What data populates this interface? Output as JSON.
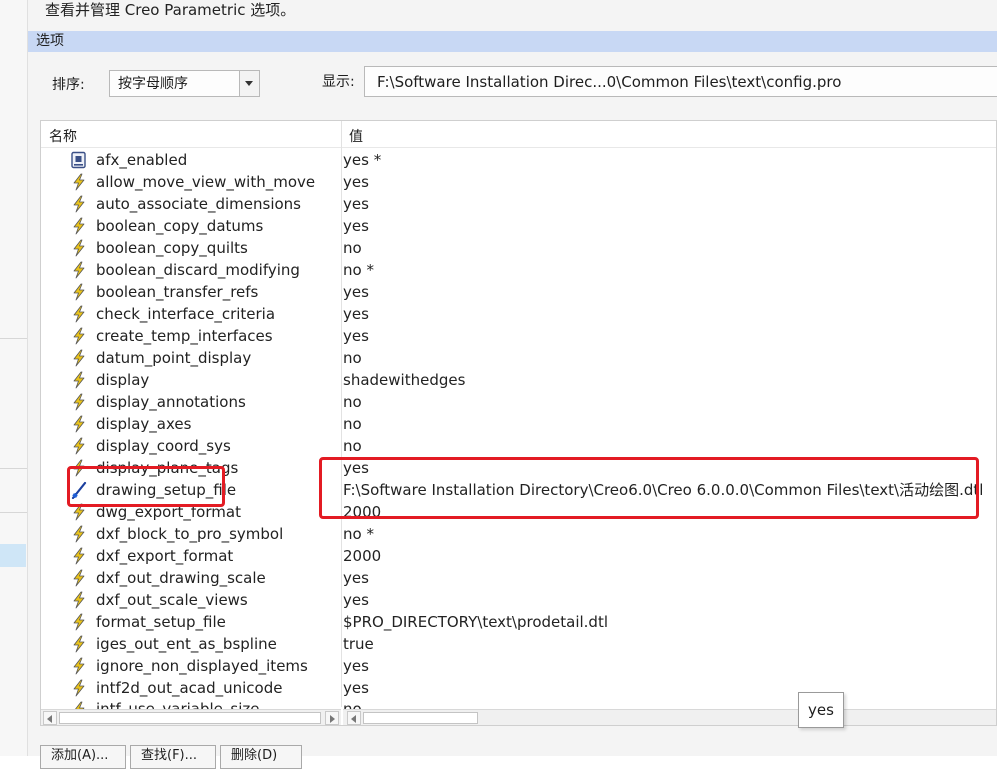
{
  "header": {
    "description": "查看并管理 Creo Parametric 选项。",
    "section_title": "选项"
  },
  "toolbar": {
    "sort_label": "排序:",
    "sort_value": "按字母顺序",
    "show_label": "显示:",
    "show_value": "F:\\Software Installation Direc...0\\Common Files\\text\\config.pro"
  },
  "table": {
    "columns": {
      "name": "名称",
      "value": "值"
    },
    "rows": [
      {
        "name": "afx_enabled",
        "value": "yes *",
        "icon": "gray-config-icon"
      },
      {
        "name": "allow_move_view_with_move",
        "value": "yes",
        "icon": "lightning-icon"
      },
      {
        "name": "auto_associate_dimensions",
        "value": "yes",
        "icon": "lightning-icon"
      },
      {
        "name": "boolean_copy_datums",
        "value": "yes",
        "icon": "lightning-icon"
      },
      {
        "name": "boolean_copy_quilts",
        "value": "no",
        "icon": "lightning-icon"
      },
      {
        "name": "boolean_discard_modifying",
        "value": "no *",
        "icon": "lightning-icon"
      },
      {
        "name": "boolean_transfer_refs",
        "value": "yes",
        "icon": "lightning-icon"
      },
      {
        "name": "check_interface_criteria",
        "value": "yes",
        "icon": "lightning-icon"
      },
      {
        "name": "create_temp_interfaces",
        "value": "yes",
        "icon": "lightning-icon"
      },
      {
        "name": "datum_point_display",
        "value": "no",
        "icon": "lightning-icon"
      },
      {
        "name": "display",
        "value": "shadewithedges",
        "icon": "lightning-icon"
      },
      {
        "name": "display_annotations",
        "value": "no",
        "icon": "lightning-icon"
      },
      {
        "name": "display_axes",
        "value": "no",
        "icon": "lightning-icon"
      },
      {
        "name": "display_coord_sys",
        "value": "no",
        "icon": "lightning-icon"
      },
      {
        "name": "display_plane_tags",
        "value": "yes",
        "icon": "lightning-icon"
      },
      {
        "name": "drawing_setup_file",
        "value": "F:\\Software Installation Directory\\Creo6.0\\Creo 6.0.0.0\\Common Files\\text\\活动绘图.dtl",
        "icon": "modified-star-icon"
      },
      {
        "name": "dwg_export_format",
        "value": "2000",
        "icon": "lightning-icon"
      },
      {
        "name": "dxf_block_to_pro_symbol",
        "value": "no *",
        "icon": "lightning-icon"
      },
      {
        "name": "dxf_export_format",
        "value": "2000",
        "icon": "lightning-icon"
      },
      {
        "name": "dxf_out_drawing_scale",
        "value": "yes",
        "icon": "lightning-icon"
      },
      {
        "name": "dxf_out_scale_views",
        "value": "yes",
        "icon": "lightning-icon"
      },
      {
        "name": "format_setup_file",
        "value": "$PRO_DIRECTORY\\text\\prodetail.dtl",
        "icon": "lightning-icon"
      },
      {
        "name": "iges_out_ent_as_bspline",
        "value": "true",
        "icon": "lightning-icon"
      },
      {
        "name": "ignore_non_displayed_items",
        "value": "yes",
        "icon": "lightning-icon"
      },
      {
        "name": "intf2d_out_acad_unicode",
        "value": "yes",
        "icon": "lightning-icon"
      },
      {
        "name": "intf_use_variable_size",
        "value": "no",
        "icon": "lightning-icon"
      }
    ]
  },
  "tooltip": {
    "text": "yes"
  },
  "bottom_buttons": [
    {
      "label": "添加(A)..."
    },
    {
      "label": "查找(F)..."
    },
    {
      "label": "删除(D)"
    }
  ],
  "colors": {
    "accent_header": "#c8d8f4",
    "highlight": "#e31b23",
    "lightning": "#e8c21a",
    "star": "#1f5fd6"
  }
}
